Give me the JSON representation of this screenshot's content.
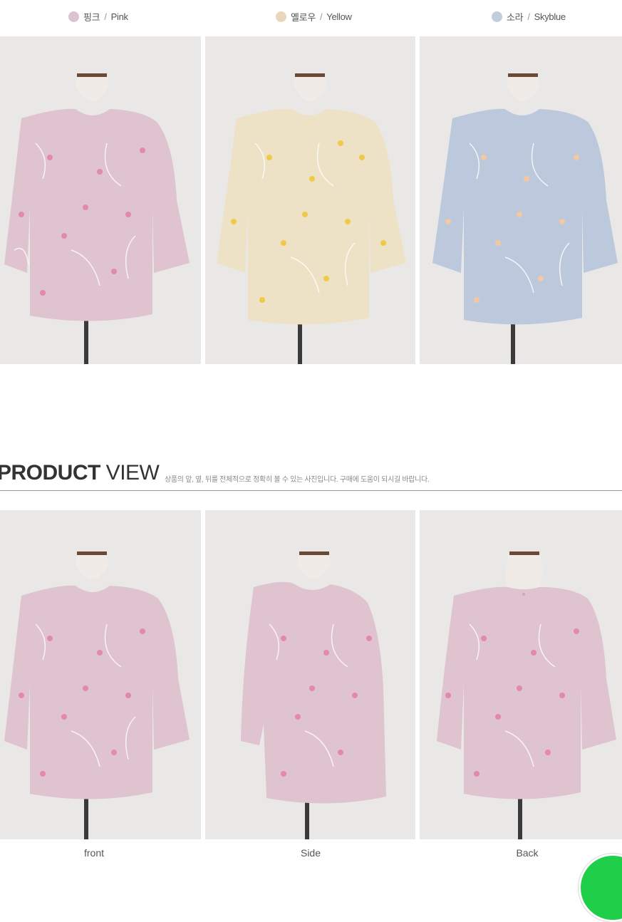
{
  "colors": [
    {
      "ko": "핑크",
      "en": "Pink",
      "swatch": "#d9c4cf"
    },
    {
      "ko": "옐로우",
      "en": "Yellow",
      "swatch": "#e8d6bd"
    },
    {
      "ko": "소라",
      "en": "Skyblue",
      "swatch": "#c3ccd9"
    }
  ],
  "separator": "/",
  "product_view": {
    "title_bold": "PRODUCT",
    "title_light": " VIEW",
    "subtitle": "상품의 앞, 옆, 뒤를 전체적으로 정확히 볼 수 있는 사진입니다. 구매에 도움이 되시길 바랍니다."
  },
  "views": [
    {
      "caption": "front"
    },
    {
      "caption": "Side"
    },
    {
      "caption": "Back"
    }
  ],
  "palette": {
    "pink_blouse": "#dfc3cf",
    "yellow_blouse": "#ede2c6",
    "blue_blouse": "#bcc8dc",
    "photo_bg": "#e9e8e6",
    "flower_pink": "#e38aa8",
    "flower_yellow": "#efc94a",
    "flower_blue": "#f2c9a0",
    "accent_badge": "#1fcf4a"
  }
}
